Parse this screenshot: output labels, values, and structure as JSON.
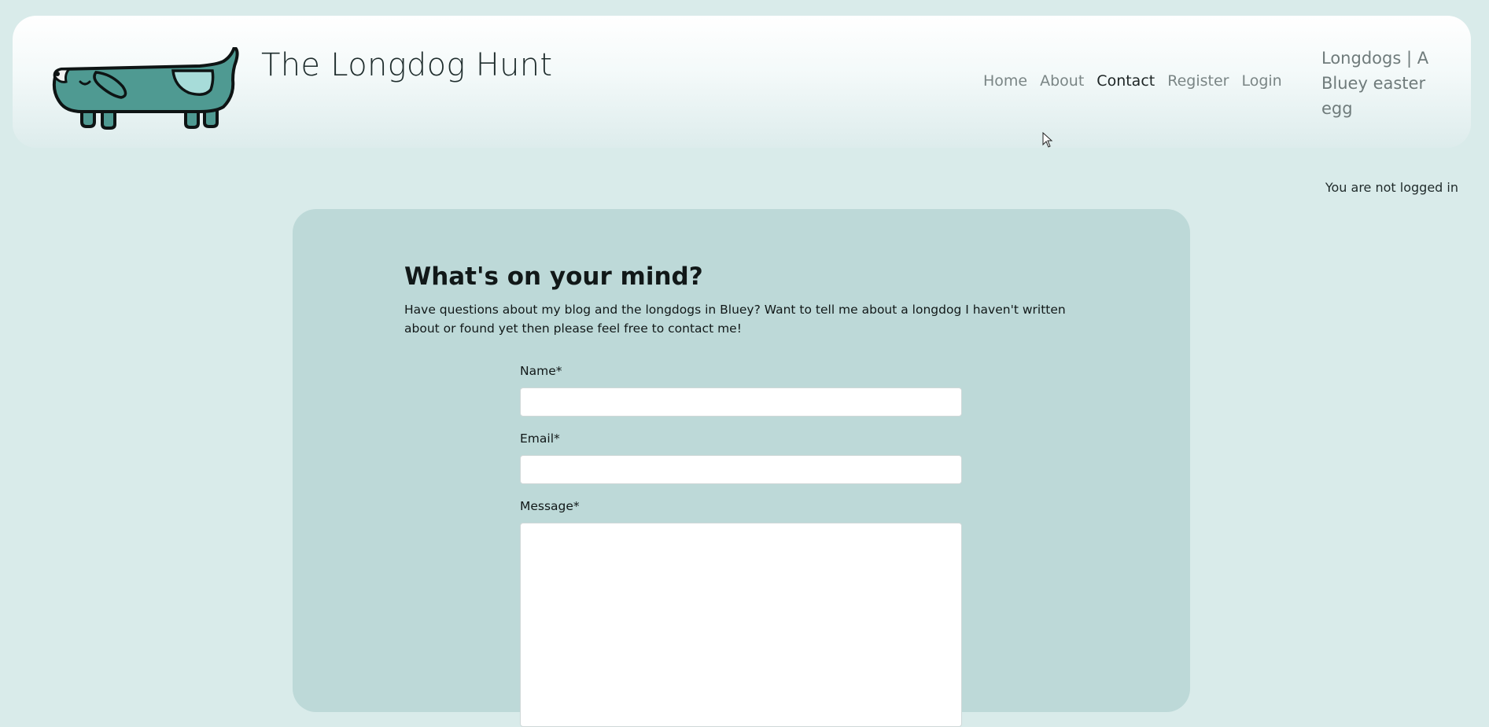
{
  "header": {
    "site_title": "The Longdog Hunt",
    "tagline": "Longdogs | A Bluey easter egg",
    "nav": [
      {
        "label": "Home",
        "active": false
      },
      {
        "label": "About",
        "active": false
      },
      {
        "label": "Contact",
        "active": true
      },
      {
        "label": "Register",
        "active": false
      },
      {
        "label": "Login",
        "active": false
      }
    ],
    "logo_icon": "longdog-logo",
    "logo_colors": {
      "body": "#4f9a92",
      "patch": "#a7dcd9",
      "outline": "#0e1414"
    }
  },
  "status": {
    "login_text": "You are not logged in"
  },
  "contact": {
    "heading": "What's on your mind?",
    "intro": "Have questions about my blog and the longdogs in Bluey? Want to tell me about a longdog I haven't written about or found yet then please feel free to contact me!",
    "fields": {
      "name": {
        "label": "Name*",
        "value": ""
      },
      "email": {
        "label": "Email*",
        "value": ""
      },
      "message": {
        "label": "Message*",
        "value": ""
      }
    }
  },
  "colors": {
    "page_bg": "#d9ebea",
    "card_bg": "#bdd9d8",
    "nav_text": "#7a8585",
    "nav_active": "#1c2424"
  }
}
